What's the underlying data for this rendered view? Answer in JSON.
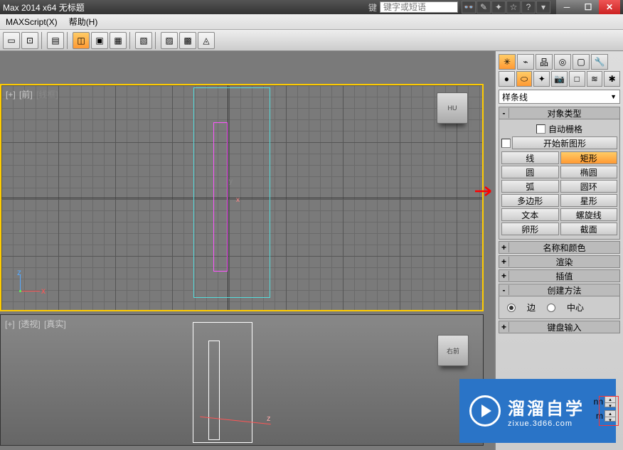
{
  "titlebar": {
    "title": "Max  2014 x64     无标题",
    "search_label": "键",
    "search_placeholder": "键字或短语"
  },
  "menubar": {
    "maxscript": "MAXScript(X)",
    "help": "帮助(H)"
  },
  "viewports": {
    "top": {
      "plus": "[+]",
      "front": "[前]",
      "mode": "[线框]"
    },
    "persp": {
      "plus": "[+]",
      "persp_label": "[透视]",
      "mode": "[真实]"
    }
  },
  "gizmo": {
    "x": "x",
    "y": "y",
    "z": "z"
  },
  "viewcube": {
    "top": "HU",
    "persp": "右前"
  },
  "panel": {
    "dropdown": "样条线",
    "rollouts": {
      "object_type": "对象类型",
      "auto_grid": "自动栅格",
      "start_new_shape": "开始新图形",
      "name_color": "名称和颜色",
      "render": "渲染",
      "interpolation": "插值",
      "creation_method": "创建方法",
      "keyboard_entry": "键盘输入"
    },
    "shapes": {
      "line": "线",
      "rectangle": "矩形",
      "circle": "圆",
      "ellipse": "椭圆",
      "arc": "弧",
      "donut": "圆环",
      "ngon": "多边形",
      "star": "星形",
      "text": "文本",
      "helix": "螺旋线",
      "egg": "卵形",
      "section": "截面"
    },
    "creation": {
      "edge": "边",
      "center": "中心"
    },
    "unit": "nn"
  },
  "watermark": {
    "big": "溜溜自学",
    "small": "zixue.3d66.com"
  }
}
